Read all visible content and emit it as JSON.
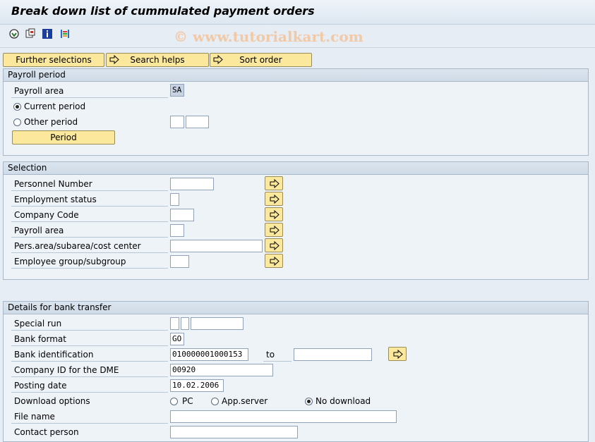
{
  "window": {
    "title": "Break down list of cummulated payment orders"
  },
  "watermark": "© www.tutorialkart.com",
  "toolbar": {
    "icons": [
      "execute-icon",
      "variant-icon",
      "info-icon",
      "selection-options-icon"
    ]
  },
  "buttons": {
    "further_selections": "Further selections",
    "search_helps": "Search helps",
    "sort_order": "Sort order"
  },
  "payroll_period": {
    "title": "Payroll period",
    "payroll_area_label": "Payroll area",
    "payroll_area_value": "SA",
    "current_period_label": "Current period",
    "other_period_label": "Other period",
    "period_button": "Period",
    "selected": "current"
  },
  "selection": {
    "title": "Selection",
    "fields": [
      {
        "label": "Personnel Number",
        "value": ""
      },
      {
        "label": "Employment status",
        "value": ""
      },
      {
        "label": "Company Code",
        "value": ""
      },
      {
        "label": "Payroll area",
        "value": ""
      },
      {
        "label": "Pers.area/subarea/cost center",
        "value": ""
      },
      {
        "label": "Employee group/subgroup",
        "value": ""
      }
    ]
  },
  "bank": {
    "title": "Details for bank transfer",
    "special_run_label": "Special run",
    "bank_format_label": "Bank format",
    "bank_format_value": "GO",
    "bank_id_label": "Bank identification",
    "bank_id_value": "010000001000153",
    "to_label": "to",
    "bank_id_to_value": "",
    "company_id_label": "Company ID for the DME",
    "company_id_value": "00920",
    "posting_date_label": "Posting date",
    "posting_date_value": "10.02.2006",
    "download_options_label": "Download options",
    "download_pc": "PC",
    "download_appserver": "App.server",
    "download_none": "No download",
    "download_selected": "none",
    "file_name_label": "File name",
    "file_name_value": "",
    "contact_person_label": "Contact person",
    "contact_person_value": ""
  }
}
